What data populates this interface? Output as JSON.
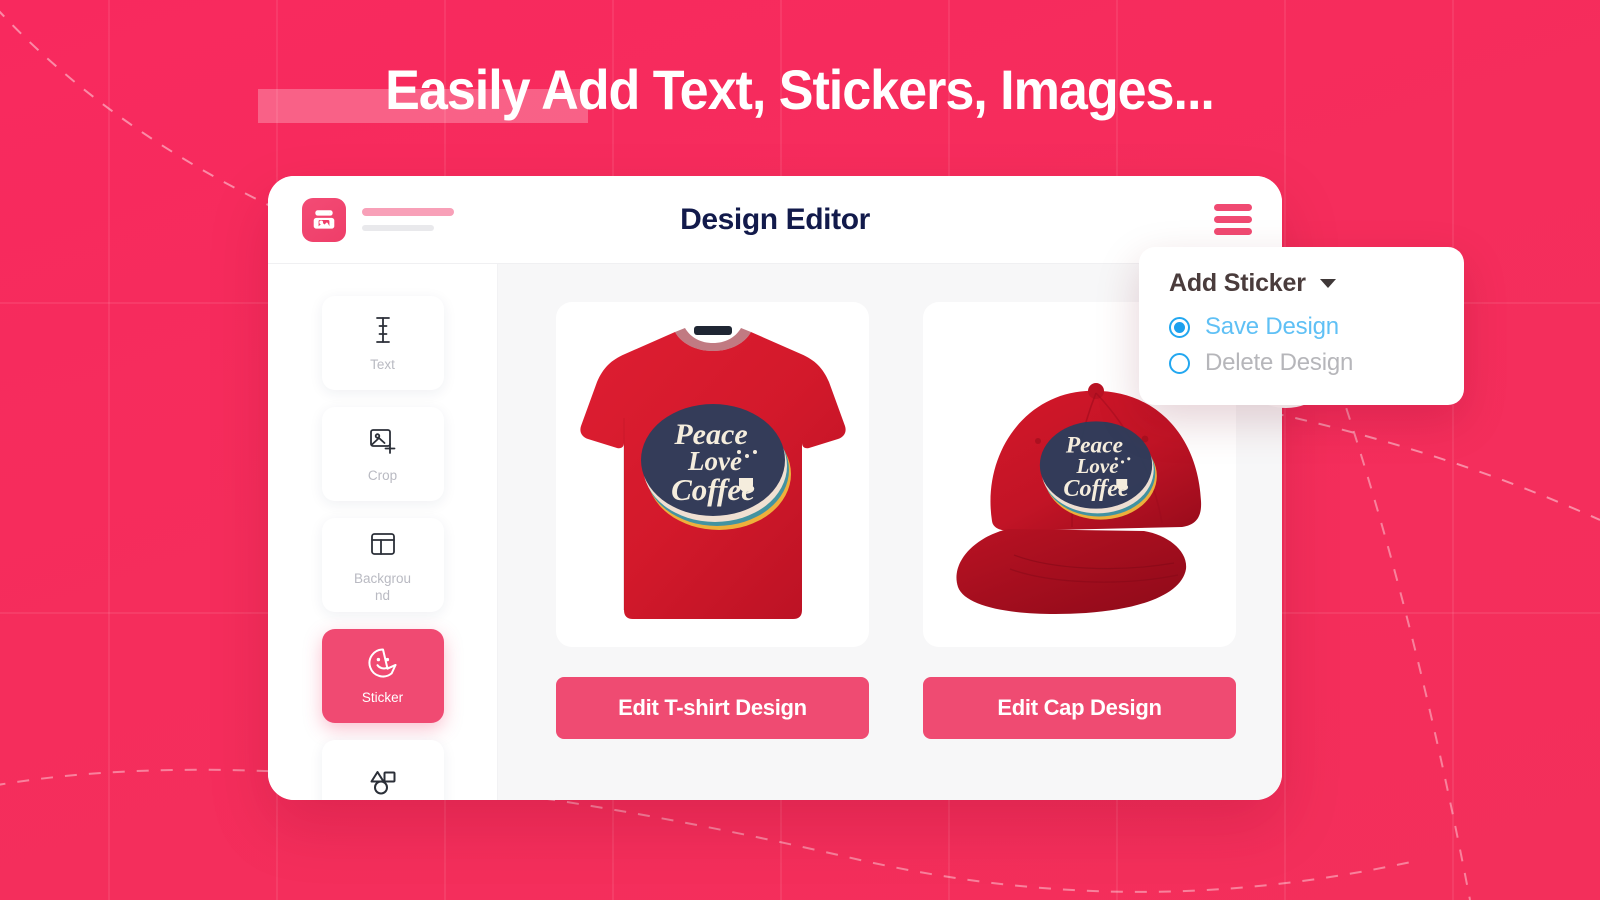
{
  "headline": {
    "text": "Easily Add Text, Stickers, Images...",
    "highlight_note": "highlight-bar"
  },
  "theme": {
    "background": "#F8295E",
    "accent_pink": "#F04A72",
    "title_navy": "#121A4B",
    "radio_blue": "#1CA0EE",
    "canvas_gray": "#F7F7F8"
  },
  "topbar": {
    "title": "Design Editor",
    "logo_icon": "plotter-printer-icon",
    "menu_icon": "hamburger-menu-icon"
  },
  "sidebar": {
    "items": [
      {
        "label": "Text",
        "icon": "text-cursor-icon",
        "active": false
      },
      {
        "label": "Crop",
        "icon": "add-image-icon",
        "active": false
      },
      {
        "label": "Background",
        "icon": "layout-icon",
        "active": false
      },
      {
        "label": "Sticker",
        "icon": "sticker-smiley-icon",
        "active": true
      },
      {
        "label": "",
        "icon": "shapes-icon",
        "active": false
      }
    ]
  },
  "products": [
    {
      "name": "t-shirt",
      "cta": "Edit T-shirt Design",
      "artwork": {
        "line1": "Peace",
        "line2": "Love",
        "line3": "Coffee"
      },
      "color": "#D0192B"
    },
    {
      "name": "cap",
      "cta": "Edit Cap Design",
      "artwork": {
        "line1": "Peace",
        "line2": "Love",
        "line3": "Coffee"
      },
      "color": "#C21426"
    }
  ],
  "dropdown": {
    "title": "Add Sticker",
    "caret_icon": "chevron-down-icon",
    "options": [
      {
        "label": "Save Design",
        "selected": true
      },
      {
        "label": "Delete Design",
        "selected": false
      }
    ]
  }
}
